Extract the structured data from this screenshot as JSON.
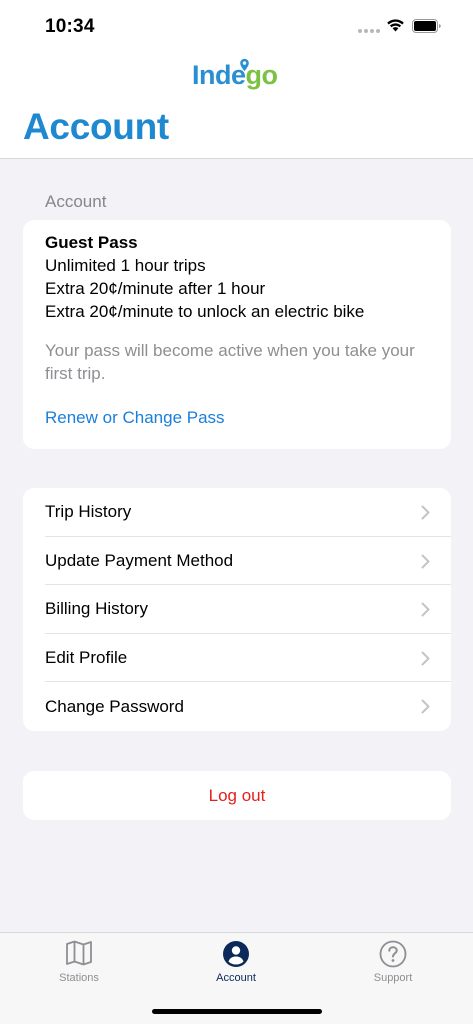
{
  "status_bar": {
    "time": "10:34"
  },
  "brand": {
    "logo_part1": "Inde",
    "logo_part2": "go",
    "blue": "#2a8fd2",
    "green": "#7cc242"
  },
  "header": {
    "title": "Account"
  },
  "account_section": {
    "label": "Account",
    "pass_name": "Guest Pass",
    "details": [
      "Unlimited 1 hour trips",
      "Extra 20¢/minute after 1 hour",
      "Extra 20¢/minute to unlock an electric bike"
    ],
    "note": "Your pass will become active when you take your first trip.",
    "renew_link": "Renew or Change Pass"
  },
  "menu": {
    "items": [
      {
        "label": "Trip History",
        "icon": "chevron-right-icon"
      },
      {
        "label": "Update Payment Method",
        "icon": "chevron-right-icon"
      },
      {
        "label": "Billing History",
        "icon": "chevron-right-icon"
      },
      {
        "label": "Edit Profile",
        "icon": "chevron-right-icon"
      },
      {
        "label": "Change Password",
        "icon": "chevron-right-icon"
      }
    ]
  },
  "logout": {
    "label": "Log out",
    "color": "#e5201e"
  },
  "tabs": [
    {
      "label": "Stations",
      "icon": "map-icon",
      "active": false
    },
    {
      "label": "Account",
      "icon": "person-circle-icon",
      "active": true
    },
    {
      "label": "Support",
      "icon": "question-circle-icon",
      "active": false
    }
  ]
}
